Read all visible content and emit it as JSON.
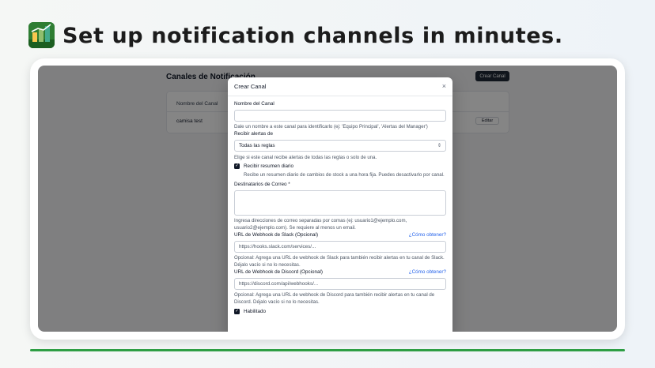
{
  "headline": "Set up notification channels in minutes.",
  "colors": {
    "brand_green": "#2e9e44",
    "primary_dark": "#111827",
    "link_blue": "#2563eb"
  },
  "icons": {
    "logo": "app-logo-icon",
    "close": "close-icon",
    "select": "chevron-updown-icon",
    "check": "check-icon"
  },
  "background_page": {
    "title": "Canales de Notificación",
    "create_button": "Crear Canal",
    "table_header": "Nombre del Canal",
    "rows": [
      {
        "name": "camisa test",
        "action": "Editar"
      }
    ]
  },
  "modal": {
    "title": "Crear Canal",
    "close_glyph": "×",
    "channel_name": {
      "label": "Nombre del Canal",
      "value": "",
      "help": "Dale un nombre a este canal para identificarlo (ej: 'Equipo Principal', 'Alertas del Manager')"
    },
    "receive_alerts": {
      "label": "Recibir alertas de",
      "value": "Todas las reglas",
      "glyph": "⇕",
      "help": "Elige si este canal recibe alertas de todas las reglas o solo de una."
    },
    "daily_summary": {
      "checked": true,
      "label": "Recibir resumen diario",
      "help": "Recibe un resumen diario de cambios de stock a una hora fija. Puedes desactivarlo por canal."
    },
    "email_recipients": {
      "label": "Destinatarios de Correo *",
      "value": "",
      "help": "Ingresa direcciones de correo separadas por comas (ej: usuario1@ejemplo.com, usuario2@ejemplo.com). Se requiere al menos un email."
    },
    "slack": {
      "label": "URL de Webhook de Slack (Opcional)",
      "link": "¿Cómo obtener?",
      "placeholder": "https://hooks.slack.com/services/...",
      "help": "Opcional: Agrega una URL de webhook de Slack para también recibir alertas en tu canal de Slack. Déjalo vacío si no lo necesitas."
    },
    "discord": {
      "label": "URL de Webhook de Discord (Opcional)",
      "link": "¿Cómo obtener?",
      "placeholder": "https://discord.com/api/webhooks/...",
      "help": "Opcional: Agrega una URL de webhook de Discord para también recibir alertas en tu canal de Discord. Déjalo vacío si no lo necesitas."
    },
    "enabled": {
      "checked": true,
      "label": "Habilitado"
    },
    "check_glyph": "✓"
  }
}
